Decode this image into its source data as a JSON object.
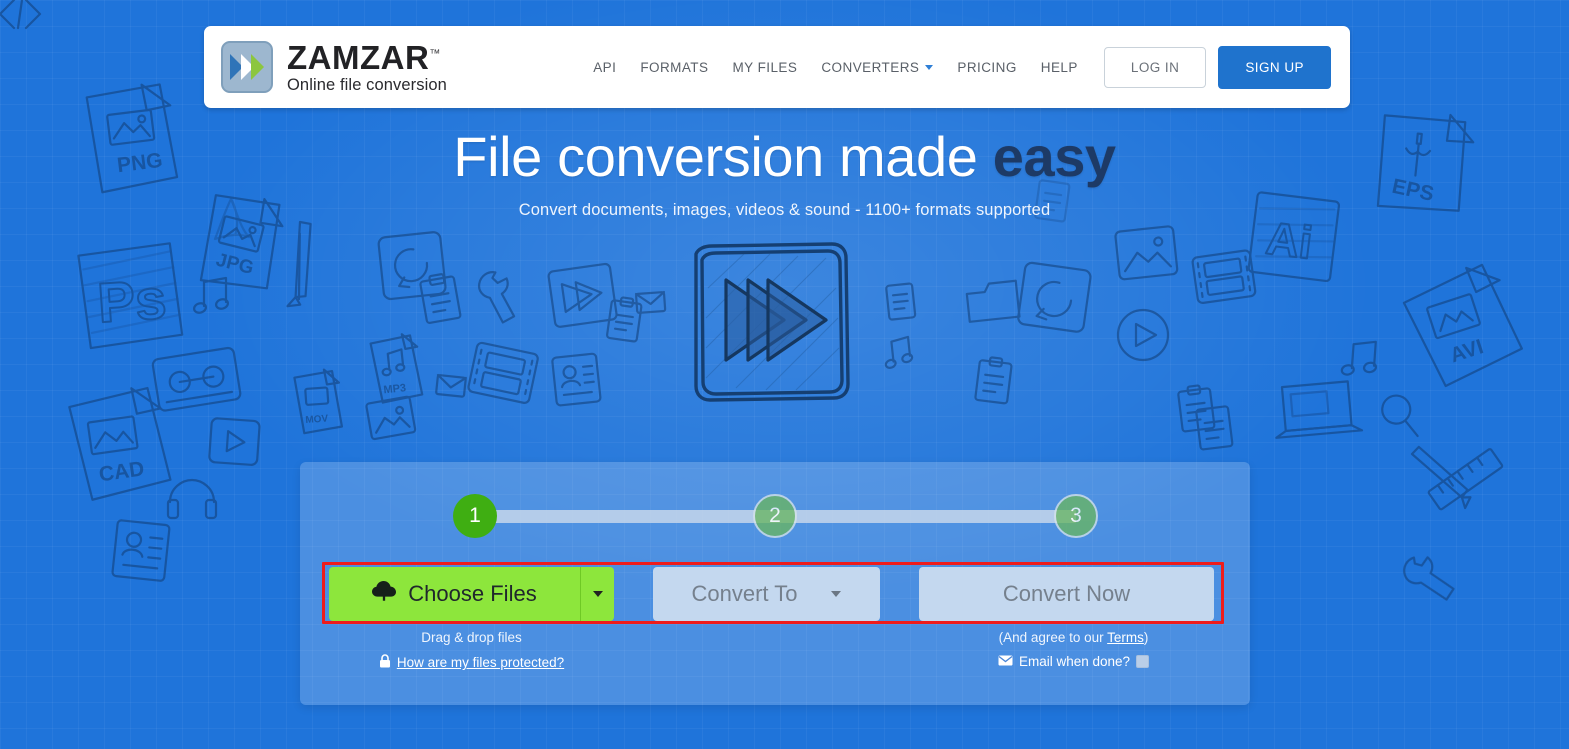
{
  "brand": {
    "name": "ZAMZAR",
    "trademark": "™",
    "tagline": "Online file conversion",
    "logo_icon": "double-chevron-logo-icon",
    "colors": {
      "chevron_blue": "#2f74b8",
      "chevron_green": "#8cc63f",
      "plate": "#9db7cf"
    }
  },
  "nav": {
    "items": [
      {
        "label": "API",
        "name": "nav-api"
      },
      {
        "label": "FORMATS",
        "name": "nav-formats"
      },
      {
        "label": "MY FILES",
        "name": "nav-my-files"
      },
      {
        "label": "CONVERTERS",
        "name": "nav-converters",
        "has_caret": true
      },
      {
        "label": "PRICING",
        "name": "nav-pricing"
      },
      {
        "label": "HELP",
        "name": "nav-help"
      }
    ],
    "login_label": "LOG IN",
    "signup_label": "SIGN UP"
  },
  "hero": {
    "title_plain": "File conversion made ",
    "title_accent": "easy",
    "subtitle": "Convert documents, images, videos & sound - 1100+ formats supported",
    "graphic_icon": "fast-forward-sketch-icon"
  },
  "converter": {
    "steps": [
      {
        "number": "1",
        "state": "active"
      },
      {
        "number": "2",
        "state": "inactive"
      },
      {
        "number": "3",
        "state": "inactive"
      }
    ],
    "choose_files_label": "Choose Files",
    "choose_files_icon": "cloud-upload-icon",
    "convert_to_label": "Convert To",
    "convert_now_label": "Convert Now",
    "drag_drop_text": "Drag & drop files",
    "protected_link": "How are my files protected?",
    "protected_icon": "padlock-icon",
    "terms_prefix": "(And agree to our ",
    "terms_link": "Terms",
    "terms_suffix": ")",
    "email_when_done_label": "Email when done?",
    "email_icon": "envelope-icon",
    "email_checked": false
  },
  "colors": {
    "page_background": "#1f74da",
    "accent_green": "#8de63c",
    "step_active_green": "#3fae12",
    "signup_blue": "#1f73cd",
    "annotation_red": "#ee1c1c",
    "disabled_button": "#c4d8ef"
  },
  "annotation": {
    "shape": "rectangle",
    "color": "#ee1c1c",
    "targets": "choose-files-convert-to-convert-now-row"
  },
  "background_sketch_labels": [
    "PNG",
    "JPG",
    "Ps",
    "CAD",
    "MP3",
    "MOV",
    "EPS",
    "Ai",
    "AVI"
  ]
}
